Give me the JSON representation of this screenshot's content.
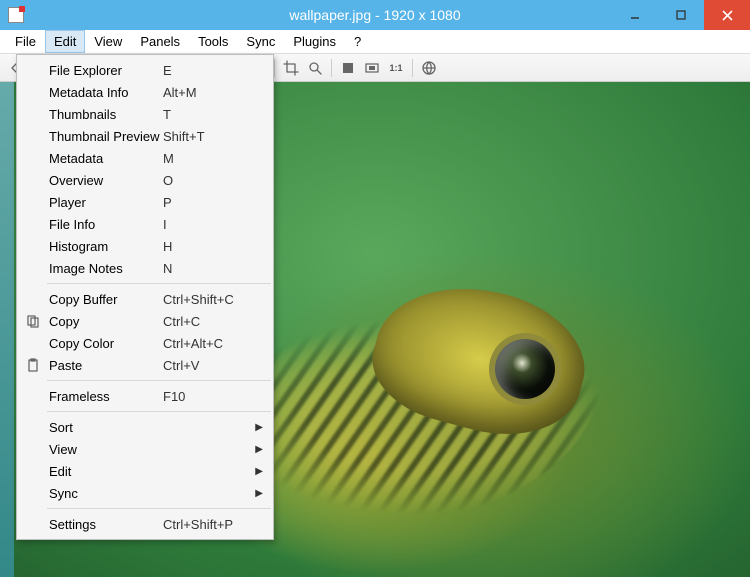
{
  "title": "wallpaper.jpg  -  1920 x 1080",
  "menubar": [
    "File",
    "Edit",
    "View",
    "Panels",
    "Tools",
    "Sync",
    "Plugins",
    "?"
  ],
  "open_menu_index": 1,
  "toolbar_icons": [
    "nav-back",
    "nav-forward",
    "sep",
    "folder-open",
    "folder",
    "save",
    "filter",
    "sep",
    "copy",
    "paste",
    "sep",
    "rotate-left",
    "rotate-right",
    "sep",
    "crop",
    "zoom-region",
    "sep",
    "fullscreen",
    "slideshow",
    "actual-size",
    "sep",
    "web"
  ],
  "dropdown": {
    "groups": [
      [
        {
          "label": "File Explorer",
          "shortcut": "E"
        },
        {
          "label": "Metadata Info",
          "shortcut": "Alt+M"
        },
        {
          "label": "Thumbnails",
          "shortcut": "T"
        },
        {
          "label": "Thumbnail Preview",
          "shortcut": "Shift+T"
        },
        {
          "label": "Metadata",
          "shortcut": "M"
        },
        {
          "label": "Overview",
          "shortcut": "O"
        },
        {
          "label": "Player",
          "shortcut": "P"
        },
        {
          "label": "File Info",
          "shortcut": "I"
        },
        {
          "label": "Histogram",
          "shortcut": "H"
        },
        {
          "label": "Image Notes",
          "shortcut": "N"
        }
      ],
      [
        {
          "label": "Copy Buffer",
          "shortcut": "Ctrl+Shift+C"
        },
        {
          "label": "Copy",
          "shortcut": "Ctrl+C",
          "icon": "copy"
        },
        {
          "label": "Copy Color",
          "shortcut": "Ctrl+Alt+C"
        },
        {
          "label": "Paste",
          "shortcut": "Ctrl+V",
          "icon": "paste"
        }
      ],
      [
        {
          "label": "Frameless",
          "shortcut": "F10"
        }
      ],
      [
        {
          "label": "Sort",
          "submenu": true
        },
        {
          "label": "View",
          "submenu": true
        },
        {
          "label": "Edit",
          "submenu": true
        },
        {
          "label": "Sync",
          "submenu": true
        }
      ],
      [
        {
          "label": "Settings",
          "shortcut": "Ctrl+Shift+P"
        }
      ]
    ]
  }
}
